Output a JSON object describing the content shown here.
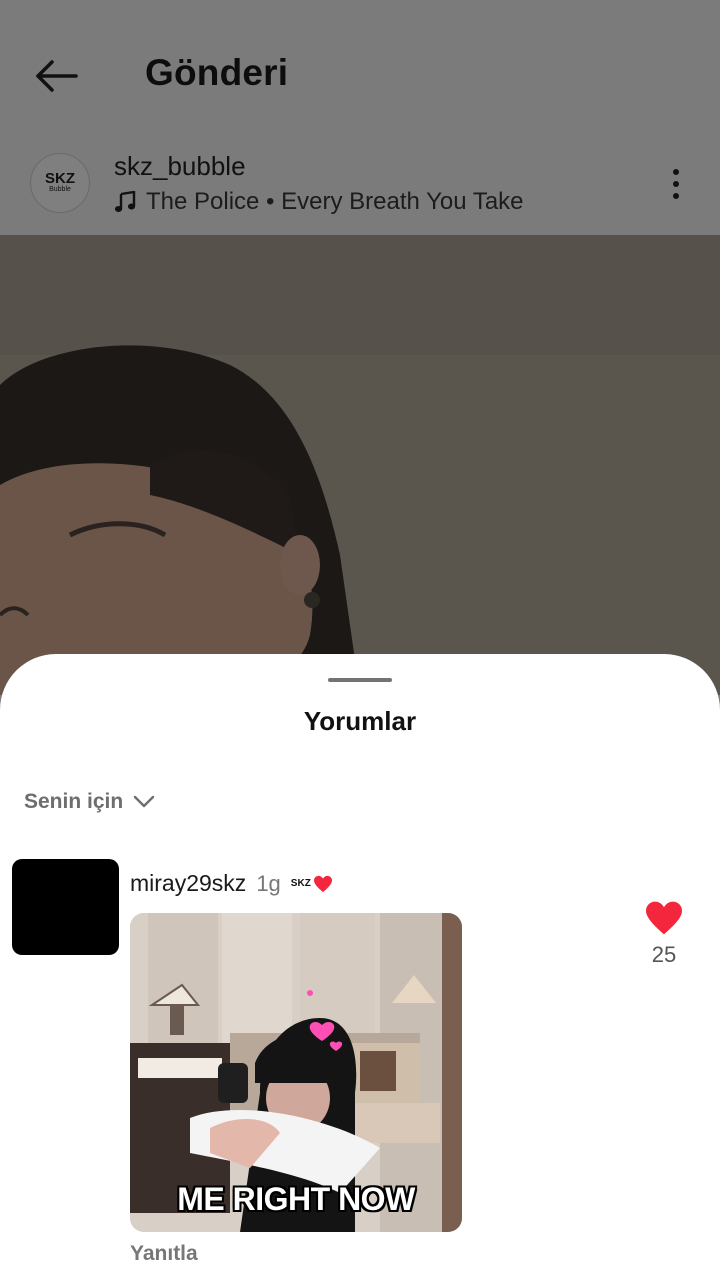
{
  "header": {
    "title": "Gönderi",
    "back_icon": "arrow-left-icon"
  },
  "post": {
    "avatar_text": "SKZ",
    "avatar_subtext": "Bubble",
    "username": "skz_bubble",
    "music_icon": "music-note-icon",
    "music": "The Police • Every Breath You Take",
    "more_icon": "more-vertical-icon"
  },
  "comments_sheet": {
    "title": "Yorumlar",
    "sort_label": "Senin için",
    "comment": {
      "username": "miray29skz",
      "time": "1g",
      "badge_text": "SKZ",
      "gif_caption": "ME RIGHT NOW",
      "like_count": "25",
      "reply_label": "Yanıtla"
    }
  },
  "colors": {
    "like_red": "#f3263d",
    "overlay_gray": "#7b7b7b",
    "sheet_bg": "#ffffff"
  }
}
